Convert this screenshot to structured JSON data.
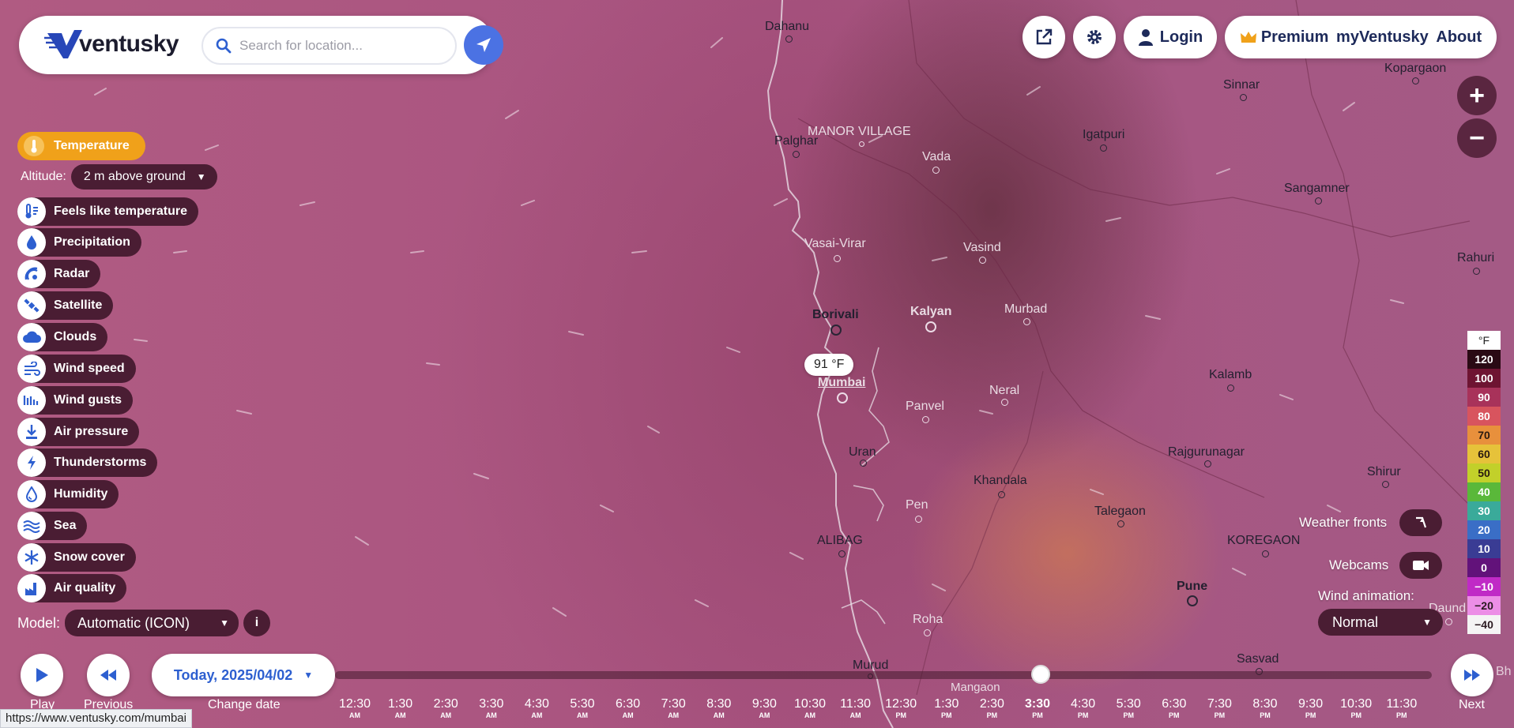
{
  "header": {
    "logo_text": "ventusky",
    "search_placeholder": "Search for location...",
    "login_label": "Login",
    "premium_label": "Premium",
    "my_label": "myVentusky",
    "about_label": "About"
  },
  "layers": {
    "active_label": "Temperature",
    "altitude_label": "Altitude:",
    "altitude_value": "2 m above ground",
    "items": [
      {
        "label": "Feels like temperature",
        "icon": "thermometer-feels-icon"
      },
      {
        "label": "Precipitation",
        "icon": "drop-icon"
      },
      {
        "label": "Radar",
        "icon": "radar-icon"
      },
      {
        "label": "Satellite",
        "icon": "satellite-icon"
      },
      {
        "label": "Clouds",
        "icon": "cloud-icon"
      },
      {
        "label": "Wind speed",
        "icon": "wind-icon"
      },
      {
        "label": "Wind gusts",
        "icon": "gusts-icon"
      },
      {
        "label": "Air pressure",
        "icon": "pressure-icon"
      },
      {
        "label": "Thunderstorms",
        "icon": "lightning-icon"
      },
      {
        "label": "Humidity",
        "icon": "humidity-icon"
      },
      {
        "label": "Sea",
        "icon": "waves-icon"
      },
      {
        "label": "Snow cover",
        "icon": "snowflake-icon"
      },
      {
        "label": "Air quality",
        "icon": "factory-icon"
      }
    ],
    "model_label": "Model:",
    "model_value": "Automatic (ICON)",
    "info_label": "i"
  },
  "map": {
    "cities": [
      {
        "name": "Dahanu"
      },
      {
        "name": "MANOR VILLAGE"
      },
      {
        "name": "Palghar"
      },
      {
        "name": "Vada"
      },
      {
        "name": "Igatpuri"
      },
      {
        "name": "Sinnar"
      },
      {
        "name": "Kopargaon"
      },
      {
        "name": "Sangamner"
      },
      {
        "name": "Vasai-Virar"
      },
      {
        "name": "Vasind"
      },
      {
        "name": "Rahuri"
      },
      {
        "name": "Borivali"
      },
      {
        "name": "Kalyan"
      },
      {
        "name": "Murbad"
      },
      {
        "name": "Mumbai"
      },
      {
        "name": "Kalamb"
      },
      {
        "name": "Panvel"
      },
      {
        "name": "Neral"
      },
      {
        "name": "Uran"
      },
      {
        "name": "Rajgurunagar"
      },
      {
        "name": "Khandala"
      },
      {
        "name": "Shirur"
      },
      {
        "name": "Pen"
      },
      {
        "name": "Talegaon"
      },
      {
        "name": "ALIBAG"
      },
      {
        "name": "KOREGAON"
      },
      {
        "name": "Pune"
      },
      {
        "name": "Roha"
      },
      {
        "name": "Daund"
      },
      {
        "name": "Murud"
      },
      {
        "name": "Sasvad"
      },
      {
        "name": "Mangaon"
      }
    ],
    "temp_popup": "91 °F"
  },
  "right_panel": {
    "weather_fronts_label": "Weather fronts",
    "webcams_label": "Webcams",
    "wind_animation_label": "Wind animation:",
    "wind_animation_value": "Normal",
    "zoom_in": "+",
    "zoom_out": "−"
  },
  "legend": {
    "unit": "°F",
    "steps": [
      {
        "label": "120",
        "color": "#2a0a14",
        "text": "#ffffff"
      },
      {
        "label": "100",
        "color": "#6e1432",
        "text": "#ffffff"
      },
      {
        "label": "90",
        "color": "#a8325a",
        "text": "#ffffff"
      },
      {
        "label": "80",
        "color": "#d8545e",
        "text": "#ffffff"
      },
      {
        "label": "70",
        "color": "#e8903c",
        "text": "#2a1a10"
      },
      {
        "label": "60",
        "color": "#e6c23a",
        "text": "#2a1a10"
      },
      {
        "label": "50",
        "color": "#c2d02a",
        "text": "#2a1a10"
      },
      {
        "label": "40",
        "color": "#5ab83a",
        "text": "#ffffff"
      },
      {
        "label": "30",
        "color": "#3aaa9a",
        "text": "#ffffff"
      },
      {
        "label": "20",
        "color": "#3a6ec6",
        "text": "#ffffff"
      },
      {
        "label": "10",
        "color": "#3a3c94",
        "text": "#ffffff"
      },
      {
        "label": "0",
        "color": "#62127a",
        "text": "#ffffff"
      },
      {
        "label": "−10",
        "color": "#c02ac6",
        "text": "#ffffff"
      },
      {
        "label": "−20",
        "color": "#ec8ee6",
        "text": "#2a1a20"
      },
      {
        "label": "−40",
        "color": "#f4f4f4",
        "text": "#2a1a20"
      }
    ]
  },
  "timeline": {
    "play_label": "Play",
    "previous_label": "Previous",
    "next_label": "Next",
    "next_clip": "Bh",
    "date_label": "Today, 2025/04/02",
    "change_date_label": "Change date",
    "times": [
      {
        "t": "12:30",
        "ap": "AM"
      },
      {
        "t": "1:30",
        "ap": "AM"
      },
      {
        "t": "2:30",
        "ap": "AM"
      },
      {
        "t": "3:30",
        "ap": "AM"
      },
      {
        "t": "4:30",
        "ap": "AM"
      },
      {
        "t": "5:30",
        "ap": "AM"
      },
      {
        "t": "6:30",
        "ap": "AM"
      },
      {
        "t": "7:30",
        "ap": "AM"
      },
      {
        "t": "8:30",
        "ap": "AM"
      },
      {
        "t": "9:30",
        "ap": "AM"
      },
      {
        "t": "10:30",
        "ap": "AM"
      },
      {
        "t": "11:30",
        "ap": "AM"
      },
      {
        "t": "12:30",
        "ap": "PM"
      },
      {
        "t": "1:30",
        "ap": "PM"
      },
      {
        "t": "2:30",
        "ap": "PM"
      },
      {
        "t": "3:30",
        "ap": "PM"
      },
      {
        "t": "4:30",
        "ap": "PM"
      },
      {
        "t": "5:30",
        "ap": "PM"
      },
      {
        "t": "6:30",
        "ap": "PM"
      },
      {
        "t": "7:30",
        "ap": "PM"
      },
      {
        "t": "8:30",
        "ap": "PM"
      },
      {
        "t": "9:30",
        "ap": "PM"
      },
      {
        "t": "10:30",
        "ap": "PM"
      },
      {
        "t": "11:30",
        "ap": "PM"
      }
    ],
    "current": "3:30 PM"
  },
  "status_bar": {
    "url": "https://www.ventusky.com/mumbai"
  }
}
